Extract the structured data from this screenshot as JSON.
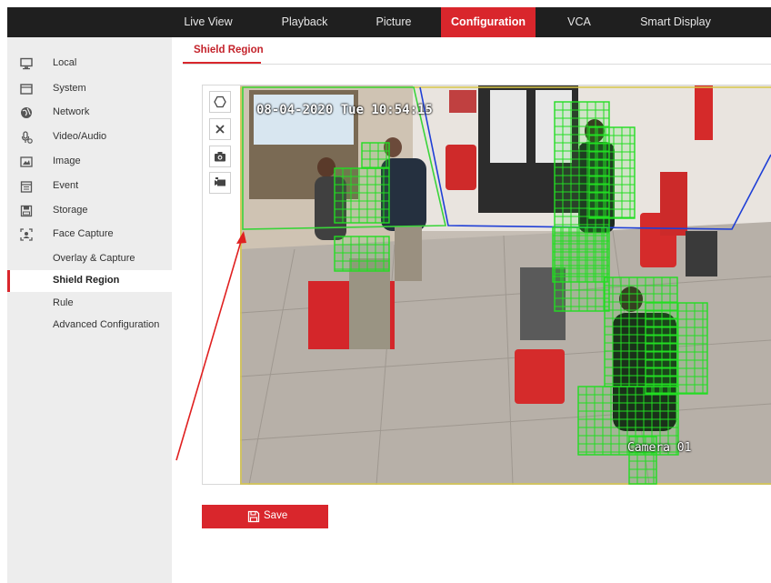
{
  "nav": {
    "tabs": [
      {
        "label": "Live View",
        "active": false
      },
      {
        "label": "Playback",
        "active": false
      },
      {
        "label": "Picture",
        "active": false
      },
      {
        "label": "Configuration",
        "active": true
      },
      {
        "label": "VCA",
        "active": false
      },
      {
        "label": "Smart Display",
        "active": false
      }
    ]
  },
  "sidebar": {
    "items": [
      {
        "label": "Local",
        "icon": "monitor-icon"
      },
      {
        "label": "System",
        "icon": "system-icon"
      },
      {
        "label": "Network",
        "icon": "globe-icon"
      },
      {
        "label": "Video/Audio",
        "icon": "microphone-icon"
      },
      {
        "label": "Image",
        "icon": "image-icon"
      },
      {
        "label": "Event",
        "icon": "calendar-icon"
      },
      {
        "label": "Storage",
        "icon": "storage-icon"
      },
      {
        "label": "Face Capture",
        "icon": "face-capture-icon"
      }
    ],
    "subitems": [
      {
        "label": "Overlay & Capture",
        "active": false
      },
      {
        "label": "Shield Region",
        "active": true
      },
      {
        "label": "Rule",
        "active": false
      },
      {
        "label": "Advanced Configuration",
        "active": false
      }
    ]
  },
  "page": {
    "tab_label": "Shield Region"
  },
  "video": {
    "osd_datetime": "08-04-2020 Tue 10:54:15",
    "osd_camera": "Camera 01",
    "tools": [
      "polygon-icon",
      "clear-icon",
      "snapshot-icon",
      "record-icon"
    ]
  },
  "save": {
    "label": "Save",
    "icon": "save-icon"
  },
  "colors": {
    "accent": "#d9262c",
    "topbar": "#1f1f1f",
    "sidebar": "#ededed",
    "shield_grid": "#22dd22",
    "region_green": "#3ad43a",
    "region_blue": "#1f3fd6",
    "region_yellow": "#d8c84a",
    "annotation_arrow": "#e02020"
  }
}
